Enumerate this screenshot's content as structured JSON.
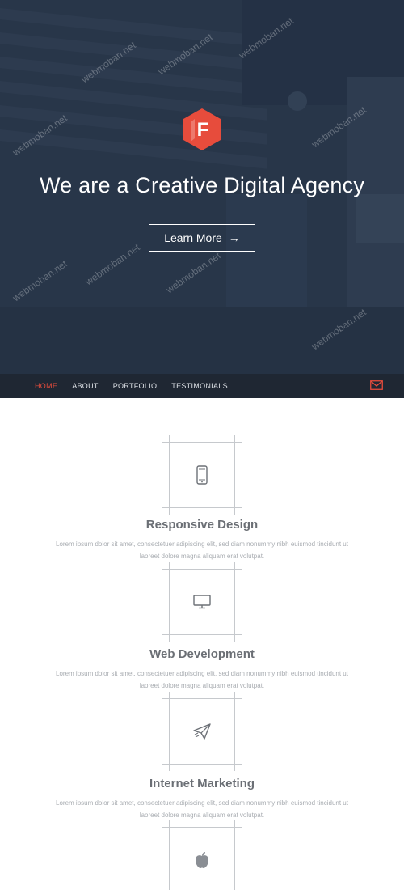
{
  "hero": {
    "logo_letter": "F",
    "title": "We are a Creative Digital Agency",
    "button_label": "Learn More",
    "button_arrow": "→"
  },
  "nav": {
    "items": [
      {
        "label": "HOME",
        "active": true
      },
      {
        "label": "ABOUT",
        "active": false
      },
      {
        "label": "PORTFOLIO",
        "active": false
      },
      {
        "label": "TESTIMONIALS",
        "active": false
      }
    ],
    "mail_icon": "mail-icon"
  },
  "features": [
    {
      "icon": "smartphone-icon",
      "title": "Responsive Design",
      "text_line1": "Lorem ipsum dolor sit amet, consectetuer adipiscing elit, sed diam nonummy nibh euismod tincidunt ut",
      "text_line2": "laoreet dolore magna aliquam erat volutpat."
    },
    {
      "icon": "monitor-icon",
      "title": "Web Development",
      "text_line1": "Lorem ipsum dolor sit amet, consectetuer adipiscing elit, sed diam nonummy nibh euismod tincidunt ut",
      "text_line2": "laoreet dolore magna aliquam erat volutpat."
    },
    {
      "icon": "paper-plane-icon",
      "title": "Internet Marketing",
      "text_line1": "Lorem ipsum dolor sit amet, consectetuer adipiscing elit, sed diam nonummy nibh euismod tincidunt ut",
      "text_line2": "laoreet dolore magna aliquam erat volutpat."
    },
    {
      "icon": "apple-icon"
    }
  ],
  "watermark": "webmoban.net",
  "colors": {
    "accent": "#e74c3c",
    "hero_bg": "#2b3a4e",
    "nav_bg": "#1f2733"
  }
}
